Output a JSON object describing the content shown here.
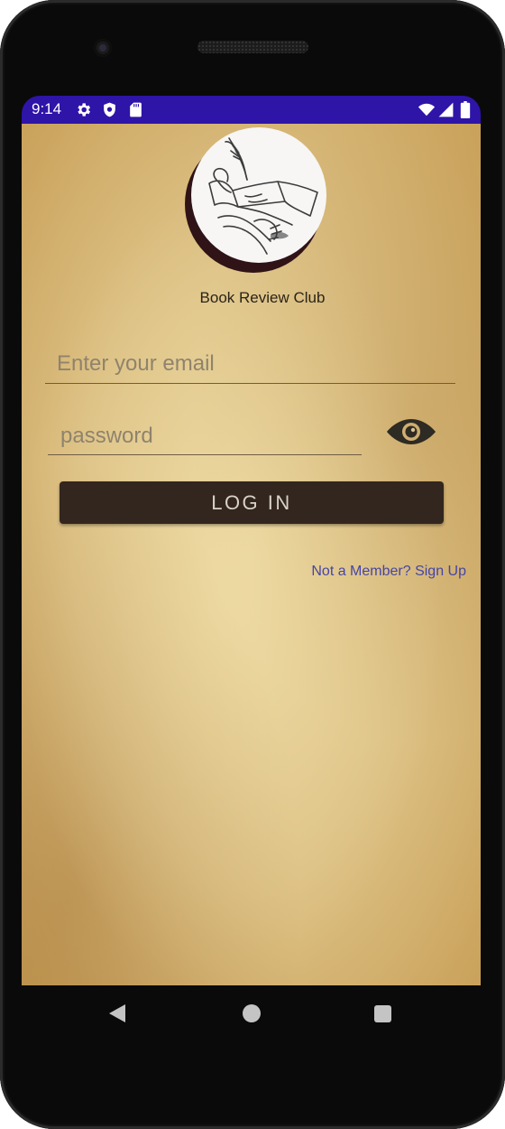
{
  "status_bar": {
    "time": "9:14",
    "background": "#2f14a8",
    "icons_left": [
      "gear-icon",
      "shield-icon",
      "sd-card-icon"
    ],
    "icons_right": [
      "wifi-icon",
      "cellular-signal-icon",
      "battery-icon"
    ]
  },
  "app": {
    "logo": "book-quill-logo",
    "title": "Book Review Club"
  },
  "login_form": {
    "email_placeholder": "Enter your email",
    "email_value": "",
    "password_placeholder": "password",
    "password_value": "",
    "toggle_icon": "eye-icon",
    "login_label": "LOG IN",
    "login_background": "#33261f",
    "signup_label": "Not a Member? Sign Up",
    "signup_color": "#4545a8"
  },
  "nav_bar": {
    "buttons": [
      "back-icon",
      "home-icon",
      "recents-icon"
    ]
  }
}
